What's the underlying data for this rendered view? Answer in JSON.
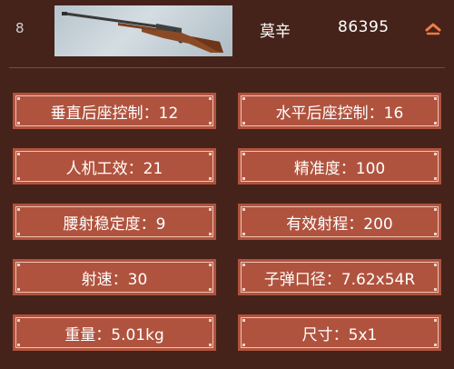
{
  "header": {
    "rank": "8",
    "weapon_name": "莫辛",
    "weapon_id": "86395",
    "collapse_icon": "chevron-up-icon",
    "image_alt_icon": "rifle-icon"
  },
  "stats": [
    {
      "label": "垂直后座控制：12"
    },
    {
      "label": "水平后座控制：16"
    },
    {
      "label": "人机工效：21"
    },
    {
      "label": "精准度：100"
    },
    {
      "label": "腰射稳定度：9"
    },
    {
      "label": "有效射程：200"
    },
    {
      "label": "射速：30"
    },
    {
      "label": "子弹口径：7.62x54R"
    },
    {
      "label": "重量：5.01kg"
    },
    {
      "label": "尺寸：5x1"
    }
  ],
  "colors": {
    "background": "#45231a",
    "card": "#b0533e",
    "card_border": "#f1c3b4",
    "accent": "#f07a45"
  }
}
